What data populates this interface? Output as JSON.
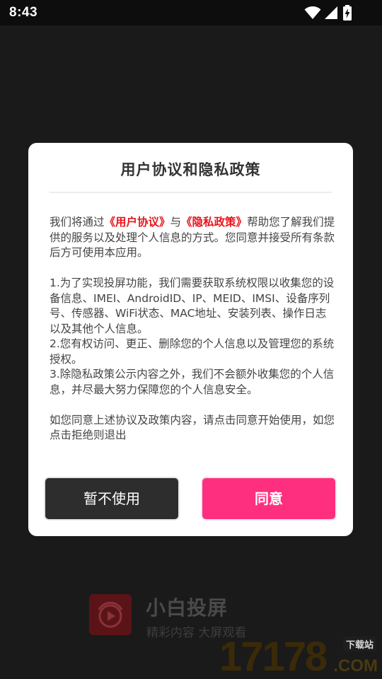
{
  "status_bar": {
    "time": "8:43"
  },
  "splash": {
    "app_name": "小白投屏",
    "slogan": "精彩内容 大屏观看"
  },
  "watermark": {
    "digits": "17178",
    "site_label": "下载站",
    "domain": ".COM"
  },
  "dialog": {
    "title": "用户协议和隐私政策",
    "intro_prefix": "我们将通过",
    "user_agreement_link": "《用户协议》",
    "intro_and": "与",
    "privacy_policy_link": "《隐私政策》",
    "intro_suffix": "帮助您了解我们提供的服务以及处理个人信息的方式。您同意并接受所有条款后方可使用本应用。",
    "item_1": "1.为了实现投屏功能，我们需要获取系统权限以收集您的设备信息、IMEI、AndroidID、IP、MEID、IMSI、设备序列号、传感器、WiFi状态、MAC地址、安装列表、操作日志以及其他个人信息。",
    "item_2": "2.您有权访问、更正、删除您的个人信息以及管理您的系统授权。",
    "item_3": "3.除隐私政策公示内容之外，我们不会额外收集您的个人信息，并尽最大努力保障您的个人信息安全。",
    "closing": "如您同意上述协议及政策内容，请点击同意开始使用，如您点击拒绝则退出",
    "decline_label": "暂不使用",
    "agree_label": "同意"
  },
  "colors": {
    "accent": "#ff2f7f",
    "link": "#e8141c",
    "decline_button": "#2d2d2d"
  }
}
